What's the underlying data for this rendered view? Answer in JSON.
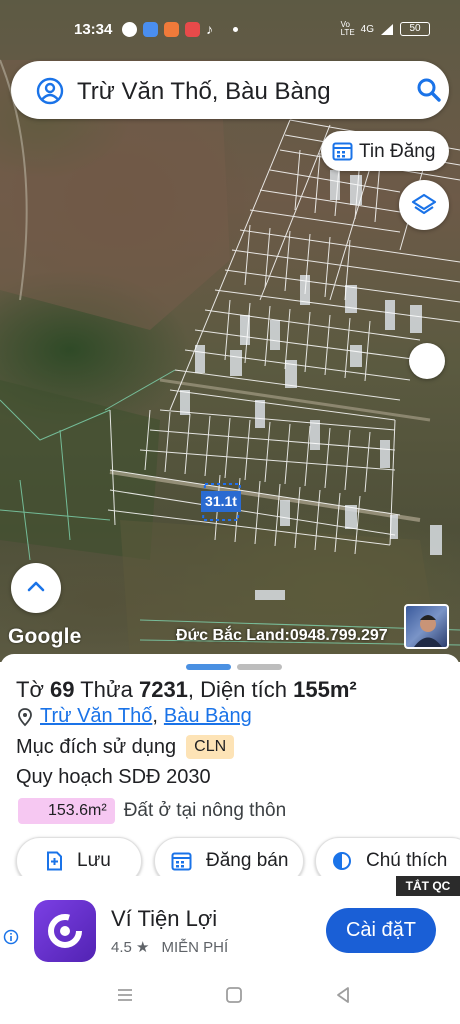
{
  "status_bar": {
    "time": "13:34",
    "network": "4G",
    "battery": "50"
  },
  "search": {
    "query": "Trừ Văn Thố, Bàu Bàng"
  },
  "map": {
    "tin_dang_label": "Tin Đăng",
    "plot_label": "31.1t",
    "google_label": "Google",
    "watermark": "Đức Bắc Land:0948.799.297"
  },
  "sheet": {
    "to_label": "Tờ",
    "to_value": "69",
    "thua_label": "Thửa",
    "thua_value": "7231",
    "dien_tich_label": "Diện tích",
    "dien_tich_value": "155m²",
    "addr_part1": "Trừ Văn Thố",
    "addr_sep": ",",
    "addr_part2": "Bàu Bàng",
    "purpose_label": "Mục đích sử dụng",
    "purpose_code": "CLN",
    "plan_label": "Quy hoạch SDĐ 2030",
    "area_value": "153.6m²",
    "area_desc": "Đất ở tại nông thôn",
    "actions": {
      "save": "Lưu",
      "sell": "Đăng bán",
      "legend": "Chú thích"
    },
    "tab_colors": [
      "#4a90e2",
      "#bdbdbd"
    ]
  },
  "ad": {
    "close_label": "TẮT QC",
    "title": "Ví Tiện Lợi",
    "rating": "4.5",
    "price": "MIỄN PHÍ",
    "install_label": "Cài đặT"
  },
  "icons": {
    "account": "account-icon",
    "search": "search-icon",
    "layers": "layers-icon",
    "chevron_up": "chevron-up-icon",
    "location_pin": "location-pin-icon",
    "save": "add-bookmark-icon",
    "sell": "listing-icon",
    "legend": "contrast-icon",
    "info": "info-icon",
    "star": "star-icon"
  }
}
